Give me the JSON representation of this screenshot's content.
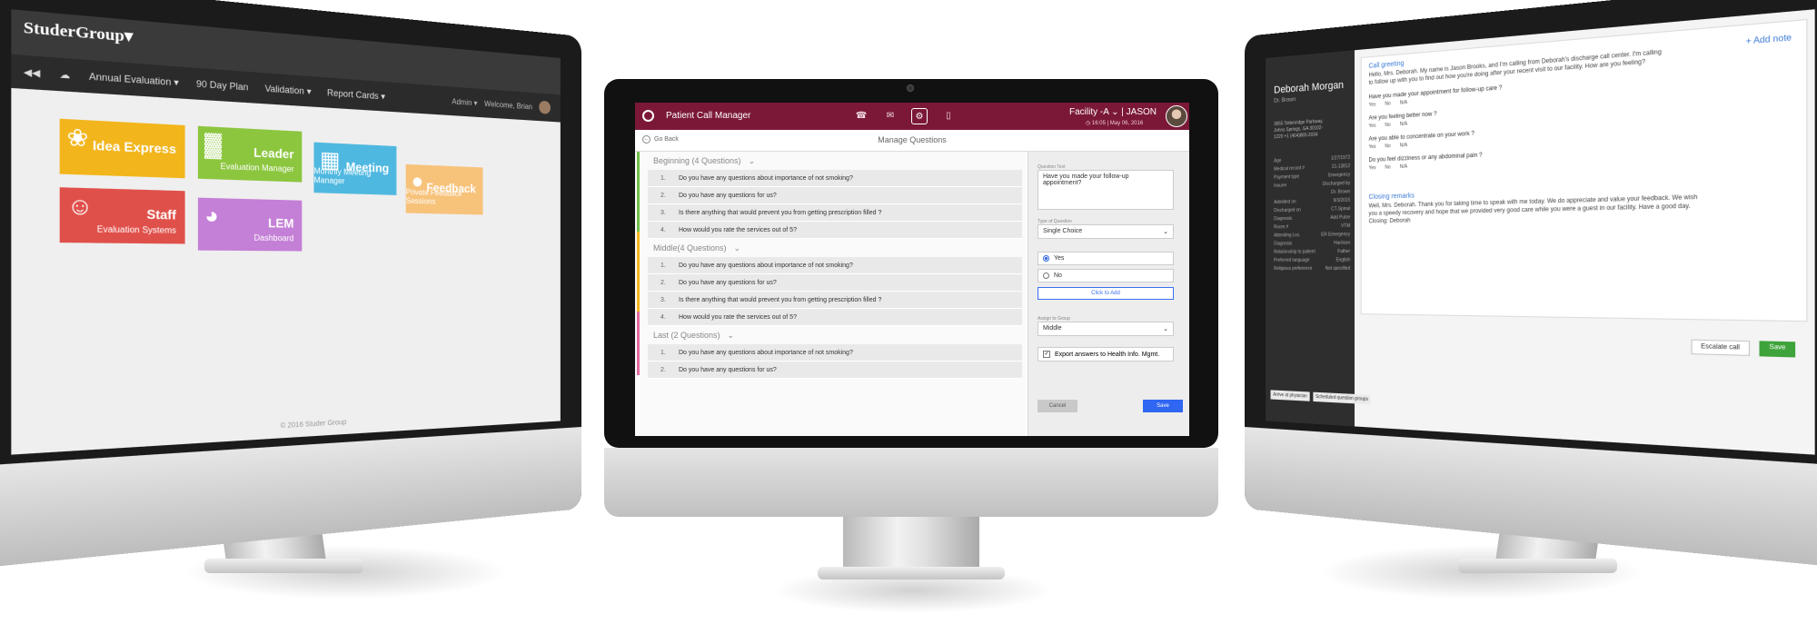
{
  "left_app": {
    "logo": "StuderGroup▾",
    "nav": [
      "Annual Evaluation ▾",
      "90 Day Plan",
      "Validation ▾",
      "Report Cards ▾"
    ],
    "user_label": "Admin ▾",
    "user_greeting": "Welcome, Brian",
    "tiles": [
      {
        "title": "Idea Express",
        "subtitle": "",
        "color": "#f2b51c",
        "icon": "lightbulb-icon",
        "glyph": "❀"
      },
      {
        "title": "Leader",
        "subtitle": "Evaluation Manager",
        "color": "#8cc63f",
        "icon": "chart-icon",
        "glyph": "▓"
      },
      {
        "title": "Meeting",
        "subtitle": "Monthly Meeting Manager",
        "color": "#4fb8e0",
        "icon": "calendar-icon",
        "glyph": "▦"
      },
      {
        "title": "Feedback",
        "subtitle": "Private Feedback Sessions",
        "color": "#f7c27a",
        "icon": "chat-icon",
        "glyph": "●"
      },
      {
        "title": "Staff",
        "subtitle": "Evaluation Systems",
        "color": "#e0504a",
        "icon": "people-icon",
        "glyph": "☺"
      },
      {
        "title": "LEM",
        "subtitle": "Dashboard",
        "color": "#c47fd6",
        "icon": "palette-icon",
        "glyph": "◕"
      }
    ],
    "footer": "© 2016 Studer Group"
  },
  "center_app": {
    "title": "Patient Call Manager",
    "header_icons": [
      {
        "name": "phone-icon",
        "glyph": "☎",
        "active": false
      },
      {
        "name": "mail-icon",
        "glyph": "✉",
        "active": false
      },
      {
        "name": "gear-icon",
        "glyph": "⚙",
        "active": true
      },
      {
        "name": "document-icon",
        "glyph": "▯",
        "active": false
      }
    ],
    "facility": "Facility -A ⌄  |  JASON",
    "datetime": "◷ 16:05 | May 06, 2016",
    "go_back": "Go Back",
    "page_title": "Manage Questions",
    "groups": [
      {
        "title": "Beginning (4 Questions)",
        "accent": "#6fbe4a",
        "questions": [
          "Do you have any questions about importance of not smoking?",
          "Do you have any questions for us?",
          "Is there anything that would prevent you from getting prescription filled ?",
          "How would you rate the services out of 5?"
        ]
      },
      {
        "title": "Middle(4 Questions)",
        "accent": "#f2b51c",
        "questions": [
          "Do you have any questions about importance of not smoking?",
          "Do you have any questions for us?",
          "Is there anything that would prevent you from getting prescription filled ?",
          "How would you rate the services out of 5?"
        ]
      },
      {
        "title": "Last (2 Questions)",
        "accent": "#e06aa0",
        "questions": [
          "Do you have any questions about importance of not smoking?",
          "Do you have any questions for us?"
        ]
      }
    ],
    "form": {
      "question_text_label": "Question Text",
      "question_text": "Have you made your follow-up appointment?",
      "type_label": "Type of Question",
      "type_value": "Single Choice",
      "options": [
        {
          "label": "Yes",
          "selected": true
        },
        {
          "label": "No",
          "selected": false
        }
      ],
      "click_to_add": "Click to Add",
      "group_label": "Assign to Group",
      "group_value": "Middle",
      "export_label": "Export answers to Health Info. Mgmt.",
      "cancel": "Cancel",
      "save": "Save"
    }
  },
  "right_app": {
    "patient_name": "Deborah Morgan",
    "patient_role": "Dr. Brown",
    "address": "3655 Tottenridge Parkway, Johns Springs, GA 30102-1220 +1 (404)865-2034",
    "side_rows": [
      [
        "Age",
        "1/27/1972"
      ],
      [
        "Medical record #",
        "21-13812"
      ],
      [
        "Payment type",
        "Emergency"
      ],
      [
        "Insurer",
        "Discharged by"
      ],
      [
        "",
        "Dr. Brown"
      ],
      [
        "Admitted on",
        "9/3/2015"
      ],
      [
        "Discharged on",
        "CT-Spinal"
      ],
      [
        "Diagnosis",
        "Add Pulse"
      ],
      [
        "Room #",
        "VTM"
      ],
      [
        "Attending Loc.",
        "ER Emergency"
      ],
      [
        "Diagnosis",
        "Harrison"
      ],
      [
        "Relationship to patient",
        "Father"
      ],
      [
        "Preferred language",
        "English"
      ],
      [
        "Religious preference",
        "Not specified"
      ]
    ],
    "side_buttons": [
      "Arrive at physician",
      "Scheduled question groups"
    ],
    "add_note": "+ Add note",
    "greeting_title": "Call greeting",
    "greeting_text": "Hello, Mrs. Deborah. My name is Jason Brooks, and I'm calling from Deborah's discharge call center. I'm calling to follow up with you to find out how you're doing after your recent visit to our facility. How are you feeling?",
    "questions": [
      "Have you made your appointment for follow-up care ?",
      "Are you feeling better now ?",
      "Are you able to concentrate on your work ?",
      "Do you feel dizziness or any abdominal pain ?"
    ],
    "answer_options": [
      "Yes",
      "No",
      "N/A"
    ],
    "closing_title": "Closing remarks",
    "closing_text": "Well, Mrs. Deborah. Thank you for taking time to speak with me today. We do appreciate and value your feedback. We wish you a speedy recovery and hope that we provided very good care while you were a guest in our facility. Have a good day. Closing: Deborah",
    "escalate": "Escalate call",
    "save": "Save"
  }
}
